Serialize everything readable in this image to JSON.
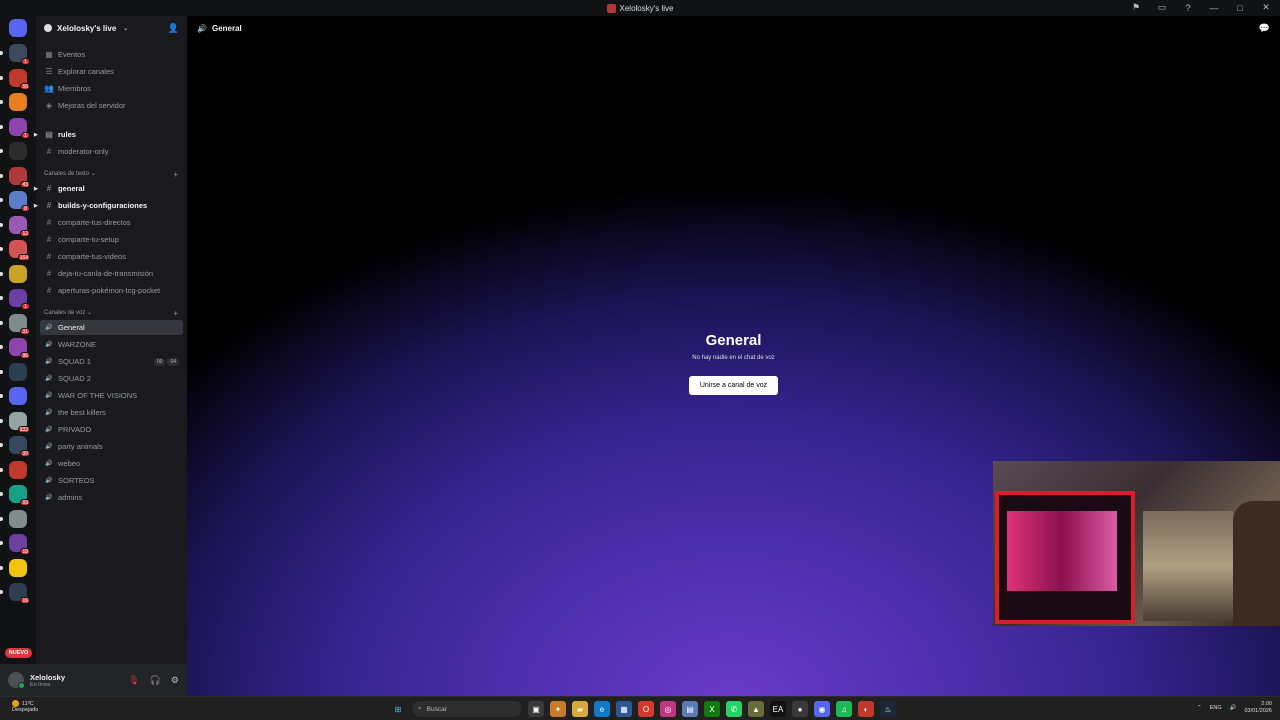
{
  "window": {
    "title": "Xelolosky's live"
  },
  "guilds": {
    "badges": [
      "1",
      "56",
      "",
      "1",
      "",
      "43",
      "8",
      "12",
      "164",
      "",
      "1",
      "31",
      "96",
      "",
      "",
      "333",
      "30",
      "",
      "93",
      "",
      "18",
      "",
      "16"
    ],
    "nuevo_label": "NUEVO"
  },
  "server": {
    "name": "Xelolosky's live"
  },
  "sidebar": {
    "nav": [
      {
        "label": "Eventos",
        "icon": "calendar-icon"
      },
      {
        "label": "Explorar canales",
        "icon": "browse-icon"
      },
      {
        "label": "Miembros",
        "icon": "members-icon"
      },
      {
        "label": "Mejoras del servidor",
        "icon": "boost-icon"
      }
    ],
    "top_channels": [
      {
        "label": "rules",
        "icon": "rules-icon"
      },
      {
        "label": "moderator-only",
        "icon": "hash-icon"
      }
    ],
    "text_category": "Canales de texto",
    "text_channels": [
      "general",
      "builds-y-configuraciones",
      "comparte-tus-directos",
      "comparte-tu-setup",
      "comparte-tus-videos",
      "deja-tu-canla-de-transmisión",
      "aperturas-pokémon-tcg-pocket"
    ],
    "voice_category": "Canales de voz",
    "voice_channels": [
      "General",
      "WARZONE",
      "SQUAD 1",
      "SQUAD 2",
      "WAR OF THE VISIONS",
      "the best killers",
      "PRIVADO",
      "party animals",
      "webeo",
      "SORTEOS",
      "admins"
    ],
    "squad1_pills": [
      "00",
      "04"
    ]
  },
  "user": {
    "name": "Xelolosky",
    "status": "En línea"
  },
  "main": {
    "header_title": "General",
    "voice_title": "General",
    "voice_subtitle": "No hay nadie en el chat de voz",
    "join_button": "Unirse a canal de voz"
  },
  "taskbar": {
    "temperature": "11ºC",
    "weather": "Despejado",
    "search_placeholder": "Buscar",
    "language": "ENG",
    "time": "2:00",
    "date": "03/01/2026"
  },
  "colors": {
    "accent_gradient": "#6a3ac9",
    "badge": "#da373c",
    "online": "#23a55a"
  }
}
